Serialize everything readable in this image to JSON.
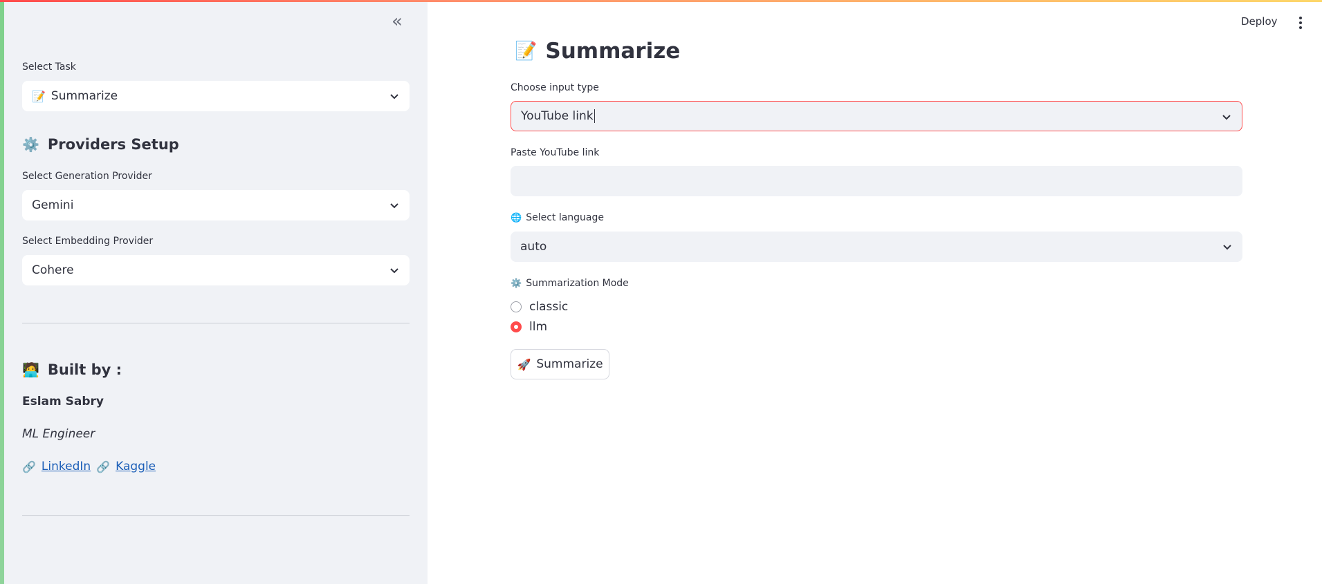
{
  "sidebar": {
    "collapse_icon": "double-chevron-left-icon",
    "task_label": "Select Task",
    "task_value": "Summarize",
    "task_emoji": "📝",
    "providers_heading": "Providers Setup",
    "providers_emoji": "⚙️",
    "generation_label": "Select Generation Provider",
    "generation_value": "Gemini",
    "embedding_label": "Select Embedding Provider",
    "embedding_value": "Cohere",
    "built_by_heading": "Built by :",
    "built_by_emoji": "🧑‍💻",
    "author_name": "Eslam Sabry",
    "author_role": "ML Engineer",
    "link_emoji": "🔗",
    "linkedin_label": "LinkedIn",
    "kaggle_label": "Kaggle"
  },
  "header": {
    "deploy_label": "Deploy",
    "menu_icon": "vertical-dots-icon"
  },
  "main": {
    "title": "Summarize",
    "title_emoji": "📝",
    "input_type_label": "Choose input type",
    "input_type_value": "YouTube link",
    "youtube_label": "Paste YouTube link",
    "youtube_value": "",
    "language_label": "Select language",
    "language_emoji": "🌐",
    "language_value": "auto",
    "mode_label": "Summarization Mode",
    "mode_emoji": "⚙️",
    "mode_options": [
      "classic",
      "llm"
    ],
    "mode_selected": "llm",
    "submit_label": "Summarize",
    "submit_emoji": "🚀"
  },
  "colors": {
    "accent": "#ff4b4b",
    "sidebar_bg": "#f0f2f6",
    "link": "#1c5fb8"
  }
}
